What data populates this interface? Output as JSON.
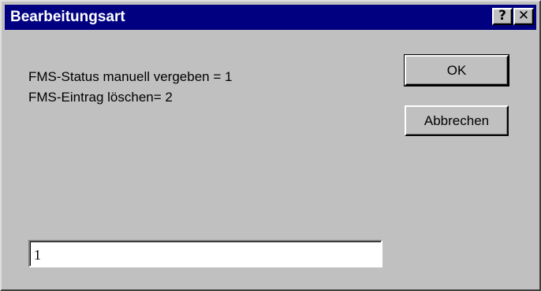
{
  "window": {
    "title": "Bearbeitungsart",
    "help_symbol": "?",
    "close_symbol": "✕"
  },
  "message": {
    "line1": "FMS-Status manuell vergeben = 1",
    "line2": "FMS-Eintrag löschen= 2"
  },
  "buttons": {
    "ok_label": "OK",
    "cancel_label": "Abbrechen"
  },
  "input": {
    "value": "1"
  },
  "colors": {
    "titlebar": "#000080",
    "window_bg": "#c0c0c0",
    "input_bg": "#ffffff"
  }
}
